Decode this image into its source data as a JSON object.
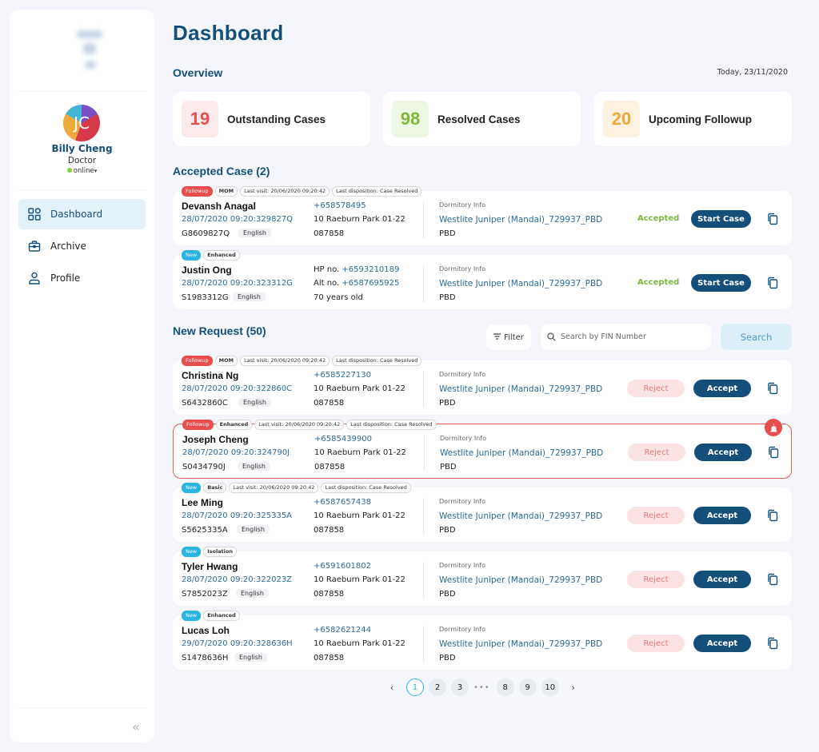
{
  "sidebar": {
    "user": {
      "initials": "JC",
      "name": "Billy Cheng",
      "role": "Doctor",
      "status": "online"
    },
    "nav": [
      {
        "label": "Dashboard",
        "icon": "grid-icon",
        "active": true
      },
      {
        "label": "Archive",
        "icon": "briefcase-icon",
        "active": false
      },
      {
        "label": "Profile",
        "icon": "user-icon",
        "active": false
      }
    ]
  },
  "header": {
    "title": "Dashboard"
  },
  "overview": {
    "title": "Overview",
    "date": "Today, 23/11/2020",
    "stats": [
      {
        "value": "19",
        "label": "Outstanding Cases",
        "color": "#e94e4e",
        "bg": "#fdeaea"
      },
      {
        "value": "98",
        "label": "Resolved Cases",
        "color": "#7fb83c",
        "bg": "#eef6e4"
      },
      {
        "value": "20",
        "label": "Upcoming Followup",
        "color": "#f0a93b",
        "bg": "#fdf1e1"
      }
    ]
  },
  "accepted": {
    "title": "Accepted Case (2)",
    "cases": [
      {
        "tags": [
          "Followup",
          "MOM",
          "Last visit: 20/06/2020 09:20:42",
          "Last disposition: Case Resolved"
        ],
        "name": "Devansh Anagal",
        "case_id": "28/07/2020 09:20:329827Q",
        "fin": "G8609827Q",
        "lang": "English",
        "line1": "",
        "phone1": "+658578495",
        "line2": "10 Raeburn Park 01-22",
        "phone2": "",
        "line3": "087858",
        "dorm_label": "Dormitory Info",
        "dorm": "Westlite Juniper (Mandai)_729937_PBD",
        "dorm_sub": "PBD",
        "status": "Accepted",
        "action": "Start Case"
      },
      {
        "tags": [
          "New",
          "Enhanced"
        ],
        "name": "Justin Ong",
        "case_id": "28/07/2020 09:20:323312G",
        "fin": "S1983312G",
        "lang": "English",
        "line1": "HP no. ",
        "phone1": "+6593210189",
        "line2": "Alt no. ",
        "phone2": "+6587695925",
        "line3": "70 years old",
        "dorm_label": "Dormitory Info",
        "dorm": "Westlite Juniper (Mandai)_729937_PBD",
        "dorm_sub": "PBD",
        "status": "Accepted",
        "action": "Start Case"
      }
    ]
  },
  "requests": {
    "title": "New Request (50)",
    "filter_label": "Filter",
    "search_placeholder": "Search by FIN Number",
    "search_label": "Search",
    "reject_label": "Reject",
    "accept_label": "Accept",
    "cases": [
      {
        "tags": [
          "Followup",
          "MOM",
          "Last visit: 20/06/2020 09:20:42",
          "Last disposition: Case Resolved"
        ],
        "name": "Christina Ng",
        "case_id": "28/07/2020 09:20:322860C",
        "fin": "S6432860C",
        "lang": "English",
        "phone1": "+6585227130",
        "line2": "10 Raeburn Park 01-22",
        "line3": "087858",
        "dorm_label": "Dormitory Info",
        "dorm": "Westlite Juniper (Mandai)_729937_PBD",
        "dorm_sub": "PBD",
        "alert": false
      },
      {
        "tags": [
          "Followup",
          "Enhanced",
          "Last visit: 20/06/2020 09:20:42",
          "Last disposition: Case Resolved"
        ],
        "name": "Joseph Cheng",
        "case_id": "28/07/2020 09:20:324790J",
        "fin": "S0434790J",
        "lang": "English",
        "phone1": "+6585439900",
        "line2": "10 Raeburn Park 01-22",
        "line3": "087858",
        "dorm_label": "Dormitory Info",
        "dorm": "Westlite Juniper (Mandai)_729937_PBD",
        "dorm_sub": "PBD",
        "alert": true
      },
      {
        "tags": [
          "New",
          "Basic",
          "Last visit: 20/06/2020 09:20:42",
          "Last disposition: Case Resolved"
        ],
        "name": "Lee Ming",
        "case_id": "28/07/2020 09:20:325335A",
        "fin": "S5625335A",
        "lang": "English",
        "phone1": "+6587657438",
        "line2": "10 Raeburn Park 01-22",
        "line3": "087858",
        "dorm_label": "Dormitory Info",
        "dorm": "Westlite Juniper (Mandai)_729937_PBD",
        "dorm_sub": "PBD",
        "alert": false
      },
      {
        "tags": [
          "New",
          "Isolation"
        ],
        "name": "Tyler Hwang",
        "case_id": "28/07/2020 09:20:322023Z",
        "fin": "S7852023Z",
        "lang": "English",
        "phone1": "+6591601802",
        "line2": "10 Raeburn Park 01-22",
        "line3": "087858",
        "dorm_label": "Dormitory Info",
        "dorm": "Westlite Juniper (Mandai)_729937_PBD",
        "dorm_sub": "PBD",
        "alert": false
      },
      {
        "tags": [
          "New",
          "Enhanced"
        ],
        "name": "Lucas Loh",
        "case_id": "29/07/2020 09:20:328636H",
        "fin": "S1478636H",
        "lang": "English",
        "phone1": "+6582621244",
        "line2": "10 Raeburn Park 01-22",
        "line3": "087858",
        "dorm_label": "Dormitory Info",
        "dorm": "Westlite Juniper (Mandai)_729937_PBD",
        "dorm_sub": "PBD",
        "alert": false
      }
    ]
  },
  "pagination": {
    "pages_start": [
      "1",
      "2",
      "3"
    ],
    "ellipsis": "•••",
    "pages_end": [
      "8",
      "9",
      "10"
    ],
    "current": "1"
  }
}
